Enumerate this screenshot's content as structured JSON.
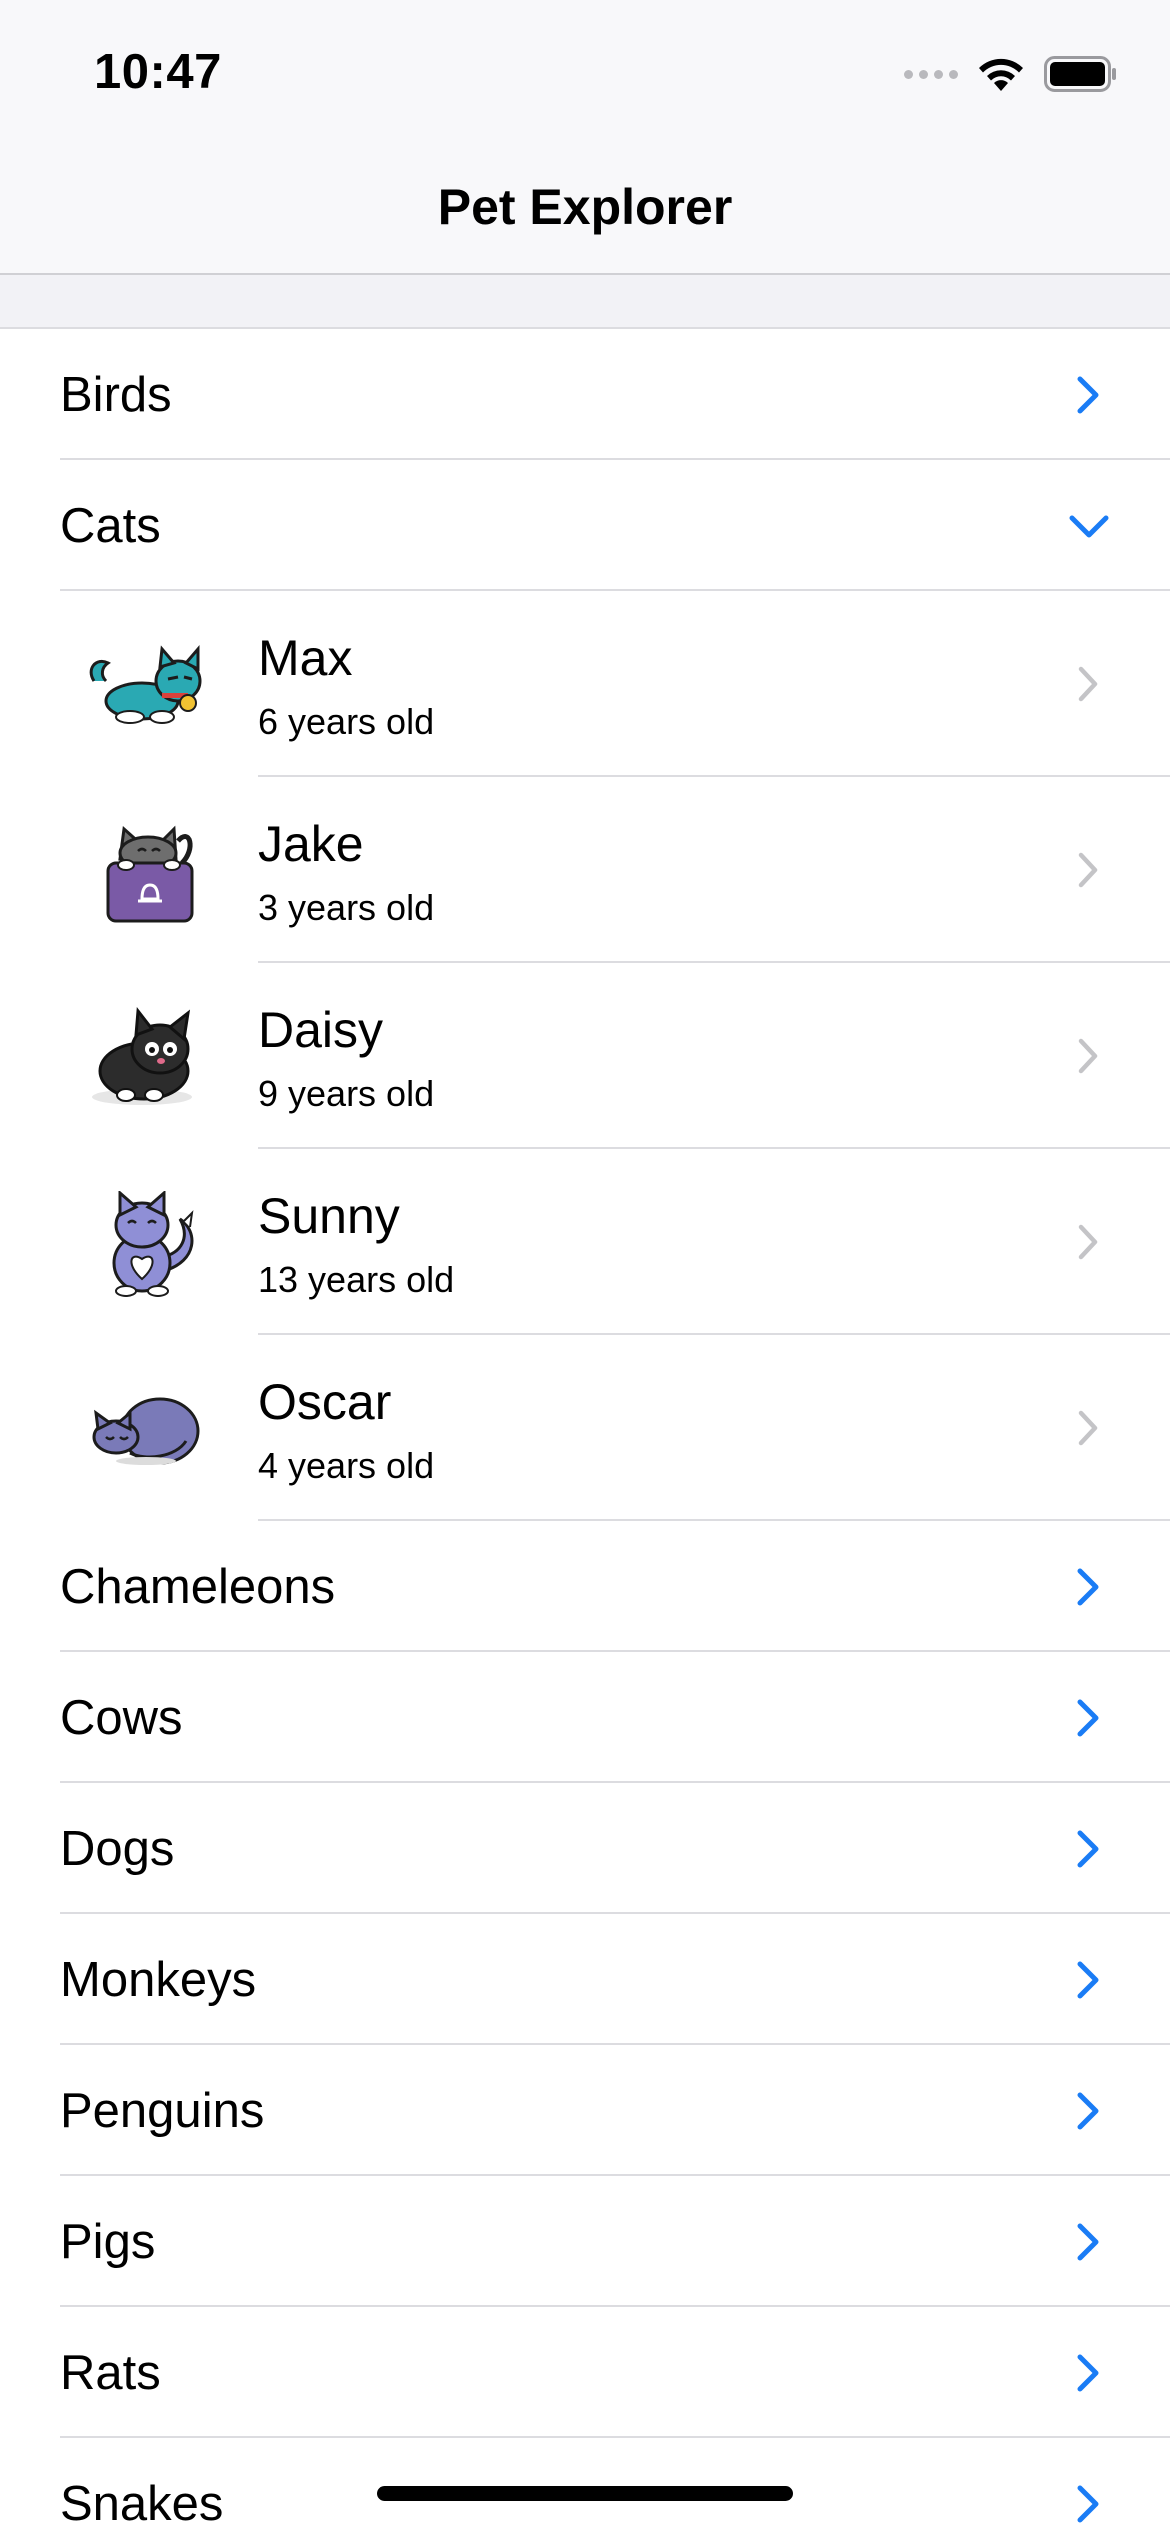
{
  "status_bar": {
    "time": "10:47"
  },
  "nav": {
    "title": "Pet Explorer"
  },
  "colors": {
    "accent": "#1a7cf5",
    "chevron_gray": "#c4c4c7",
    "separator": "#dcdce0"
  },
  "categories_before": [
    {
      "label": "Birds",
      "expanded": false
    }
  ],
  "cats": {
    "label": "Cats",
    "expanded": true,
    "pets": [
      {
        "name": "Max",
        "age": "6 years old",
        "icon": "teal-cat-icon"
      },
      {
        "name": "Jake",
        "age": "3 years old",
        "icon": "gray-cat-with-sign-icon"
      },
      {
        "name": "Daisy",
        "age": "9 years old",
        "icon": "black-cat-icon"
      },
      {
        "name": "Sunny",
        "age": "13 years old",
        "icon": "purple-sitting-cat-icon"
      },
      {
        "name": "Oscar",
        "age": "4 years old",
        "icon": "sleeping-cat-icon"
      }
    ]
  },
  "categories_after": [
    {
      "label": "Chameleons"
    },
    {
      "label": "Cows"
    },
    {
      "label": "Dogs"
    },
    {
      "label": "Monkeys"
    },
    {
      "label": "Penguins"
    },
    {
      "label": "Pigs"
    },
    {
      "label": "Rats"
    },
    {
      "label": "Snakes"
    }
  ]
}
